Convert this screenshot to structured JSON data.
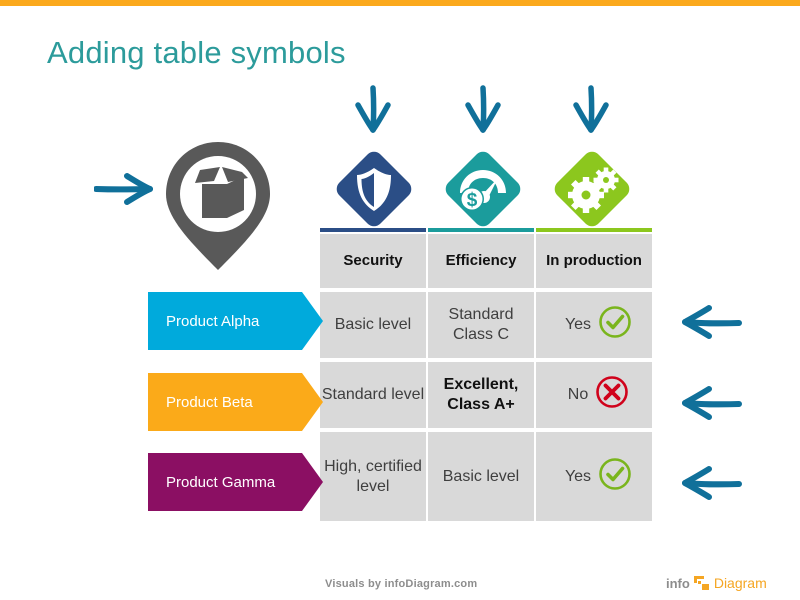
{
  "slide": {
    "title": "Adding table symbols",
    "accent_bar_color": "#FBA91D",
    "title_color": "#2C9B9B"
  },
  "left_icon": {
    "name": "package-pin-icon",
    "color": "#595959",
    "pointer_arrow": "arrow-right-hand-drawn"
  },
  "column_icons": [
    {
      "name": "shield-icon",
      "label": "Security",
      "color": "#2B4E86"
    },
    {
      "name": "speedometer-dollar-icon",
      "label": "Efficiency",
      "color": "#1B9C9C"
    },
    {
      "name": "gears-icon",
      "label": "In production",
      "color": "#8CC71E"
    }
  ],
  "table": {
    "headers": [
      "Security",
      "Efficiency",
      "In production"
    ],
    "rows": [
      {
        "product": "Product Alpha",
        "product_color": "#00AADC",
        "security": "Basic level",
        "efficiency": "Standard Class C",
        "in_production": "Yes",
        "in_production_icon": "check-circle-icon",
        "in_production_icon_color": "#7AB51D",
        "efficiency_emphasis": false
      },
      {
        "product": "Product Beta",
        "product_color": "#FBAA19",
        "security": "Standard level",
        "efficiency": "Excellent, Class A+",
        "in_production": "No",
        "in_production_icon": "cross-circle-icon",
        "in_production_icon_color": "#D0021B",
        "efficiency_emphasis": true
      },
      {
        "product": "Product Gamma",
        "product_color": "#8B0F63",
        "security": "High, certified level",
        "efficiency": "Basic level",
        "in_production": "Yes",
        "in_production_icon": "check-circle-icon",
        "in_production_icon_color": "#7AB51D",
        "efficiency_emphasis": false
      }
    ]
  },
  "annotations": {
    "down_arrows_count": 3,
    "left_arrows_count": 3,
    "arrow_color": "#10709A"
  },
  "footer": {
    "credit": "Visuals by infoDiagram.com",
    "logo_info": "info",
    "logo_diagram": "Diagram",
    "logo_color": "#F5A623"
  }
}
